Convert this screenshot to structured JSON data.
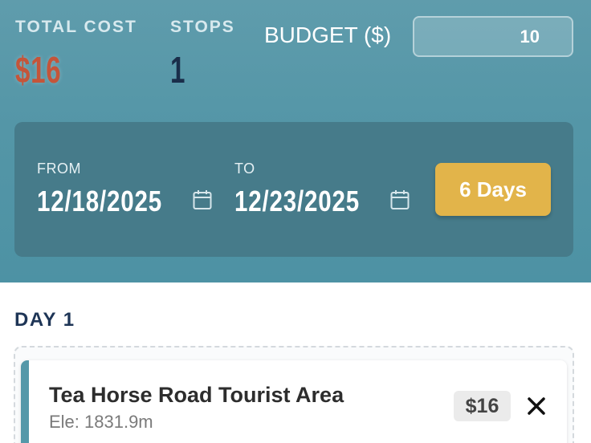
{
  "summary": {
    "total_cost_label": "TOTAL COST",
    "total_cost_value": "$16",
    "stops_label": "STOPS",
    "stops_value": "1"
  },
  "budget": {
    "label": "BUDGET ($)",
    "value": "10"
  },
  "dates": {
    "from_label": "FROM",
    "from_value": "12/18/2025",
    "to_label": "TO",
    "to_value": "12/23/2025",
    "days_button": "6 Days"
  },
  "itinerary": {
    "days": [
      {
        "title": "DAY 1",
        "stops": [
          {
            "name": "Tea Horse Road Tourist Area",
            "elevation": "Ele: 1831.9m",
            "price": "$16"
          }
        ]
      }
    ]
  },
  "icons": {
    "calendar": "calendar-icon",
    "remove": "close-icon"
  },
  "colors": {
    "header_bg": "#5496a7",
    "date_panel_bg": "#467b8a",
    "cost_accent": "#c4553a",
    "stops_accent": "#1a2e4a",
    "days_button_bg": "#e2b44a",
    "card_accent": "#5598a9"
  }
}
